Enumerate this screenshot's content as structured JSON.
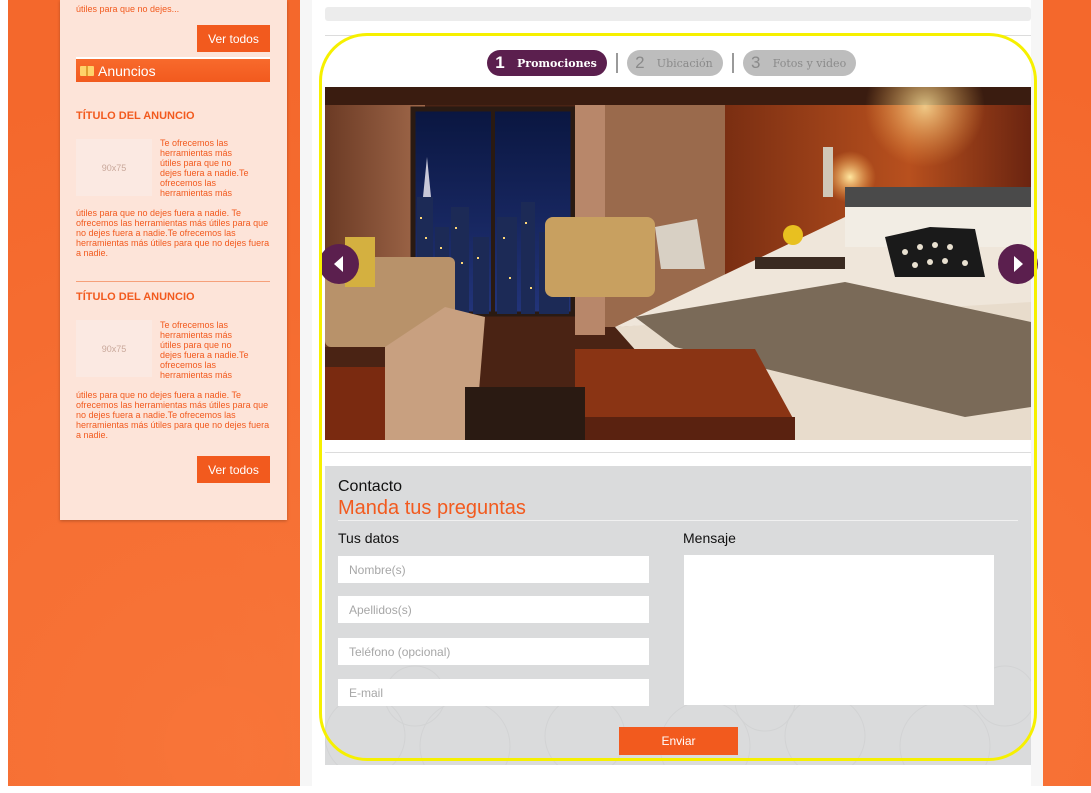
{
  "colors": {
    "page_background": "#f4682c",
    "sidebar_background": "#fde4d9",
    "accent": "#f25a1e",
    "tab_active": "#5b1f4e",
    "tab_inactive": "#bdbdbd",
    "highlight": "#f6f000"
  },
  "sidebar": {
    "top_text": "útiles para que no dejes...",
    "view_all_label": "Ver todos",
    "ads_header": "Anuncios",
    "ads_header_icon": "book-icon",
    "ads": [
      {
        "title": "TÍTULO DEL ANUNCIO",
        "thumb_label": "90x75",
        "side_text": "Te ofrecemos las herramientas más útiles para que no dejes fuera a nadie.Te ofrecemos las herramientas más",
        "body_text": "útiles para que no dejes fuera a nadie. Te ofrecemos las herramientas más útiles para que no dejes fuera a nadie.Te ofrecemos las herramientas más útiles para que no dejes fuera a nadie."
      },
      {
        "title": "TÍTULO DEL ANUNCIO",
        "thumb_label": "90x75",
        "side_text": "Te ofrecemos las herramientas más útiles para que no dejes fuera a nadie.Te ofrecemos las herramientas más",
        "body_text": "útiles para que no dejes fuera a nadie. Te ofrecemos las herramientas más útiles para que no dejes fuera a nadie.Te ofrecemos las herramientas más útiles para que no dejes fuera a nadie."
      }
    ]
  },
  "tabs": [
    {
      "number": "1",
      "label": "Promociones",
      "active": true
    },
    {
      "number": "2",
      "label": "Ubicación",
      "active": false
    },
    {
      "number": "3",
      "label": "Fotos y video",
      "active": false
    }
  ],
  "gallery": {
    "prev_icon": "chevron-left-icon",
    "next_icon": "chevron-right-icon"
  },
  "contact": {
    "title": "Contacto",
    "subtitle": "Manda tus preguntas",
    "your_data_label": "Tus datos",
    "message_label": "Mensaje",
    "fields": {
      "first_name_placeholder": "Nombre(s)",
      "last_name_placeholder": "Apellidos(s)",
      "phone_placeholder": "Teléfono (opcional)",
      "email_placeholder": "E-mail"
    },
    "submit_label": "Enviar"
  }
}
